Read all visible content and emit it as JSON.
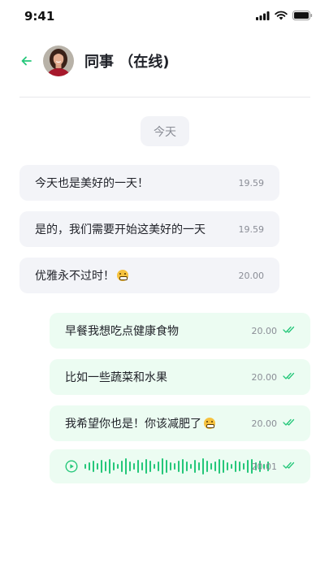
{
  "status_bar": {
    "time": "9:41"
  },
  "header": {
    "title": "同事 （在线)"
  },
  "chat": {
    "date_chip": "今天",
    "incoming": [
      {
        "text": "今天也是美好的一天！",
        "time": "19.59"
      },
      {
        "text": "是的，我们需要开始这美好的一天",
        "time": "19.59"
      },
      {
        "text": "优雅永不过时！",
        "time": "20.00"
      }
    ],
    "outgoing": [
      {
        "text": "早餐我想吃点健康食物",
        "time": "20.00"
      },
      {
        "text": "比如一些蔬菜和水果",
        "time": "20.00"
      },
      {
        "text": "我希望你也是！你该减肥了",
        "time": "20.00"
      }
    ],
    "voice_message": {
      "time": "20.01"
    }
  },
  "colors": {
    "accent": "#25c77a",
    "incoming_bubble": "#f3f4f8",
    "outgoing_bubble": "#ecfcf2",
    "timestamp": "#8a8d96"
  },
  "icons": [
    "signal-icon",
    "wifi-icon",
    "battery-icon",
    "back-arrow-icon",
    "double-check-icon",
    "play-icon",
    "waveform-icon",
    "grinning-emoji-icon"
  ]
}
